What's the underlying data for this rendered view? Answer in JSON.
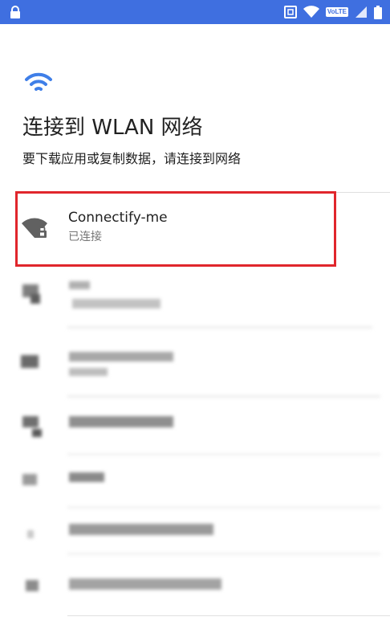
{
  "status_bar": {
    "volte_label": "VoLTE",
    "bar_color": "#3f6fe0"
  },
  "header": {
    "icon": "wifi-icon",
    "title": "连接到 WLAN 网络",
    "subtitle": "要下载应用或复制数据，请连接到网络",
    "accent_color": "#3f7fe8"
  },
  "networks": [
    {
      "name": "Connectify-me",
      "status": "已连接",
      "icon": "wifi-lock-icon",
      "highlighted": true,
      "highlight_color": "#e0262c"
    }
  ]
}
